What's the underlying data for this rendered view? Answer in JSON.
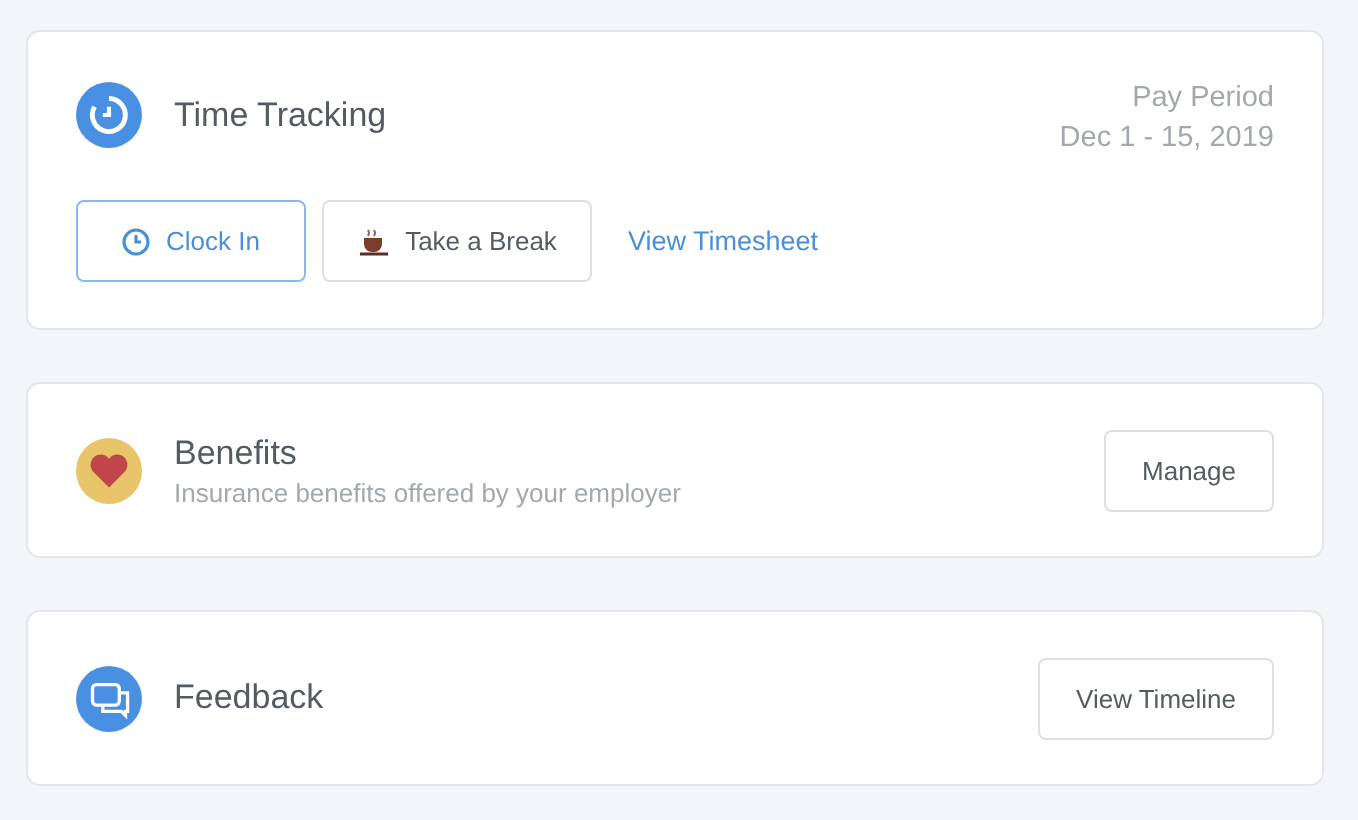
{
  "time_tracking": {
    "title": "Time Tracking",
    "pay_period": {
      "label": "Pay Period",
      "dates": "Dec 1 - 15, 2019"
    },
    "actions": [
      {
        "kind": "primary",
        "label": "Clock In"
      },
      {
        "kind": "secondary",
        "label": "Take a Break"
      },
      {
        "kind": "link",
        "label": "View Timesheet"
      }
    ]
  },
  "cards": [
    {
      "kind": "benefits",
      "title": "Benefits",
      "subtitle": "Insurance benefits offered by your employer",
      "button": "Manage"
    },
    {
      "kind": "feedback",
      "title": "Feedback",
      "button": "View Timeline"
    }
  ]
}
